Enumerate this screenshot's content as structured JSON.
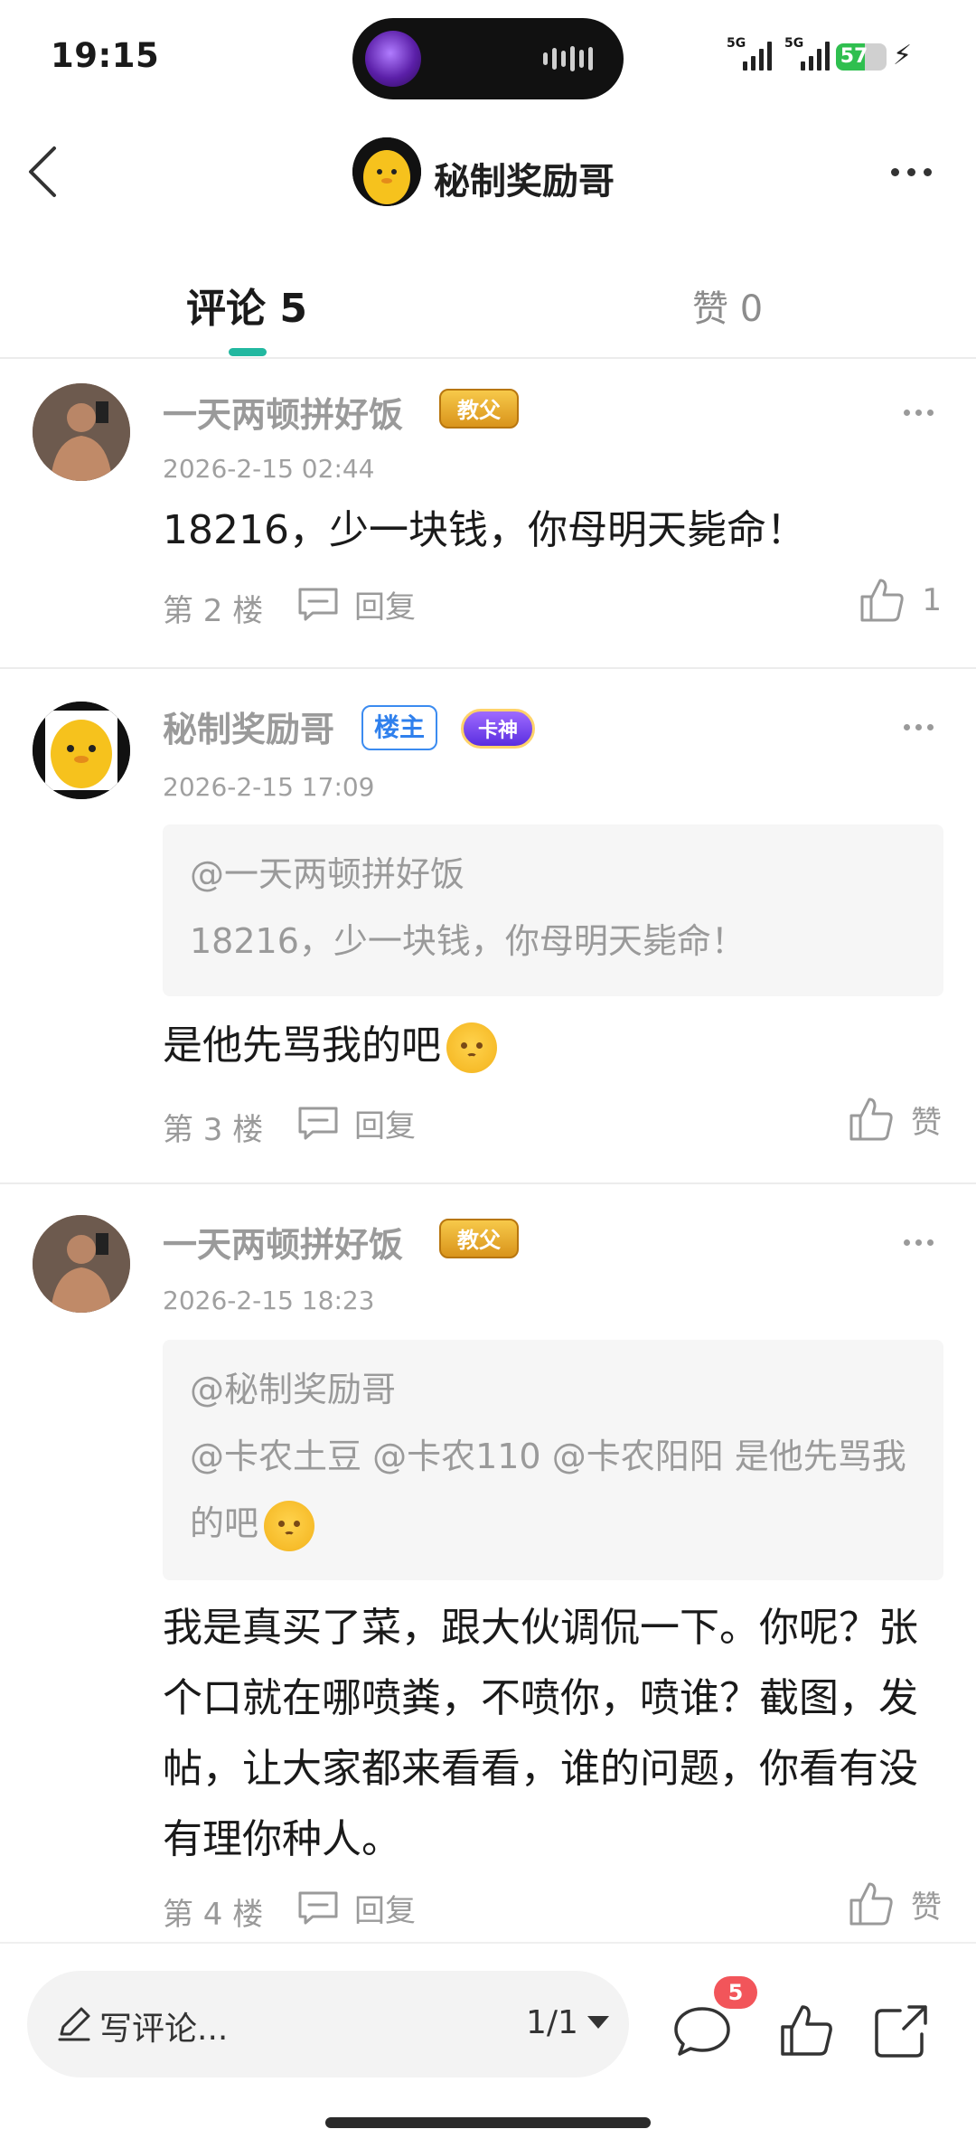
{
  "status_bar": {
    "time": "19:15",
    "network_1": "5G",
    "network_2": "5G",
    "battery": "57",
    "battery_level_percent": 57
  },
  "header": {
    "title": "秘制奖励哥"
  },
  "tabs": {
    "comments_label": "评论 5",
    "likes_label": "赞 0"
  },
  "comments": [
    {
      "username": "一天两顿拼好饭",
      "badge": "教父",
      "time": "2026-2-15 02:44",
      "content": "18216，少一块钱，你母明天毙命！",
      "floor": "第 2 楼",
      "reply_label": "回复",
      "like_label": "1"
    },
    {
      "username": "秘制奖励哥",
      "owner_badge": "楼主",
      "badge": "卡神",
      "time": "2026-2-15 17:09",
      "quote_user": "@一天两顿拼好饭",
      "quote_text": "18216，少一块钱，你母明天毙命！",
      "content": "是他先骂我的吧",
      "floor": "第 3 楼",
      "reply_label": "回复",
      "like_label": "赞"
    },
    {
      "username": "一天两顿拼好饭",
      "badge": "教父",
      "time": "2026-2-15 18:23",
      "quote_user": "@秘制奖励哥",
      "quote_text": "@卡农土豆 @卡农110 @卡农阳阳 是他先骂我的吧",
      "content": "我是真买了菜，跟大伙调侃一下。你呢？张个口就在哪喷粪，不喷你，喷谁？截图，发帖，让大家都来看看，谁的问题，你看有没有理你种人。",
      "floor": "第 4 楼",
      "reply_label": "回复",
      "like_label": "赞"
    }
  ],
  "bottom_bar": {
    "write_placeholder": "写评论...",
    "page_indicator": "1/1",
    "comment_count": "5"
  },
  "colors": {
    "accent": "#22b8a0",
    "owner_badge": "#2f80ed",
    "notification": "#f2555a"
  }
}
